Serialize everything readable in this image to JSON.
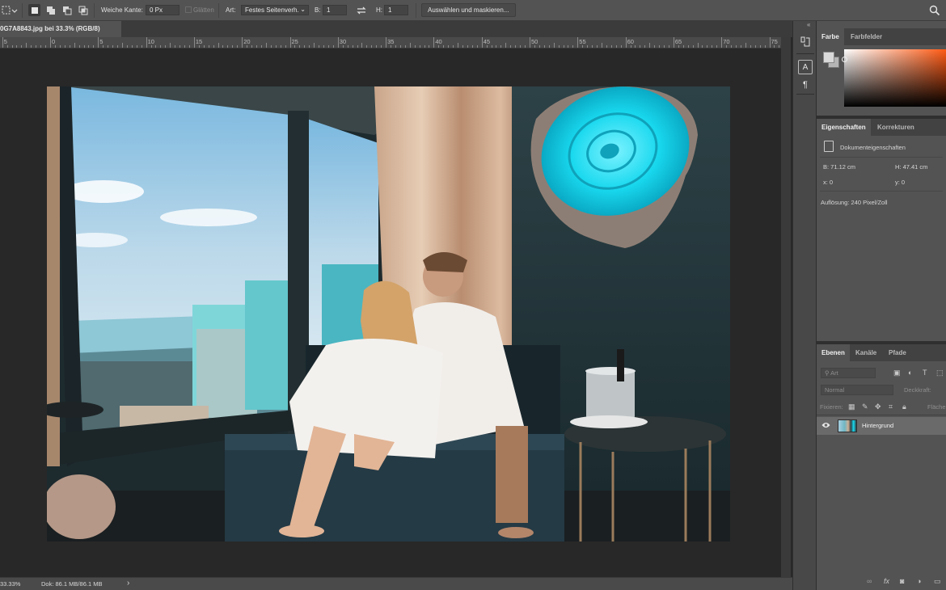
{
  "options_bar": {
    "feather_label": "Weiche Kante:",
    "feather_value": "0 Px",
    "antialias_label": "Glätten",
    "style_label": "Art:",
    "style_value": "Festes Seitenverh.",
    "width_label": "B:",
    "width_value": "1",
    "height_label": "H:",
    "height_value": "1",
    "select_mask_button": "Auswählen und maskieren..."
  },
  "document": {
    "tab_title": "0G7A8843.jpg bei 33.3% (RGB/8)"
  },
  "ruler": {
    "labels": [
      "5",
      "0",
      "5",
      "10",
      "15",
      "20",
      "25",
      "30",
      "35",
      "40",
      "45",
      "50",
      "55",
      "60",
      "65",
      "70",
      "75"
    ]
  },
  "status_bar": {
    "zoom": "33.33%",
    "doc_size": "Dok: 86.1 MB/86.1 MB",
    "arrow": "›"
  },
  "color_panel": {
    "tab_color": "Farbe",
    "tab_swatches": "Farbfelder",
    "foreground": "#d9d9d9",
    "background": "#b5b5b5"
  },
  "properties_panel": {
    "tab_properties": "Eigenschaften",
    "tab_adjustments": "Korrekturen",
    "doc_props": "Dokumenteigenschaften",
    "width": "B: 71.12 cm",
    "height": "H: 47.41 cm",
    "x": "x: 0",
    "y": "y: 0",
    "resolution": "Auflösung: 240 Pixel/Zoll"
  },
  "layers_panel": {
    "tab_layers": "Ebenen",
    "tab_channels": "Kanäle",
    "tab_paths": "Pfade",
    "filter_placeholder": "Art",
    "blend_mode": "Normal",
    "opacity_label": "Deckkraft:",
    "lock_label": "Fixieren:",
    "fill_label": "Fläche:",
    "layers": [
      {
        "name": "Hintergrund",
        "visible": true
      }
    ]
  },
  "colors": {
    "accent_cyan": "#18d8ee",
    "app_bg": "#282828",
    "panel_bg": "#535353"
  }
}
